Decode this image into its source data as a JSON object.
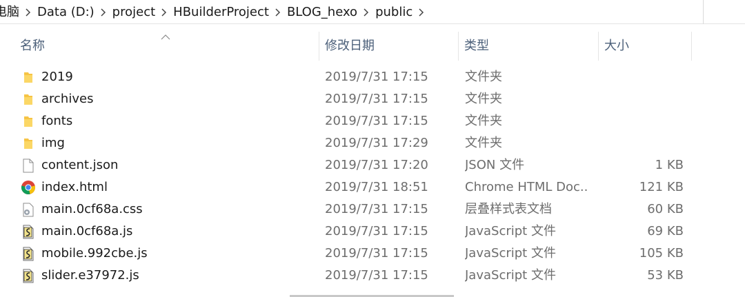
{
  "breadcrumb": {
    "items": [
      "电脑",
      "Data (D:)",
      "project",
      "HBuilderProject",
      "BLOG_hexo",
      "public"
    ]
  },
  "columns": {
    "name": "名称",
    "date": "修改日期",
    "type": "类型",
    "size": "大小"
  },
  "files": [
    {
      "name": "2019",
      "date": "2019/7/31 17:15",
      "type": "文件夹",
      "size": "",
      "icon": "folder-icon"
    },
    {
      "name": "archives",
      "date": "2019/7/31 17:15",
      "type": "文件夹",
      "size": "",
      "icon": "folder-icon"
    },
    {
      "name": "fonts",
      "date": "2019/7/31 17:15",
      "type": "文件夹",
      "size": "",
      "icon": "folder-icon"
    },
    {
      "name": "img",
      "date": "2019/7/31 17:29",
      "type": "文件夹",
      "size": "",
      "icon": "folder-icon"
    },
    {
      "name": "content.json",
      "date": "2019/7/31 17:20",
      "type": "JSON 文件",
      "size": "1 KB",
      "icon": "blank-file-icon"
    },
    {
      "name": "index.html",
      "date": "2019/7/31 18:51",
      "type": "Chrome HTML Doc...",
      "size": "121 KB",
      "icon": "chrome-icon"
    },
    {
      "name": "main.0cf68a.css",
      "date": "2019/7/31 17:15",
      "type": "层叠样式表文档",
      "size": "60 KB",
      "icon": "css-file-icon"
    },
    {
      "name": "main.0cf68a.js",
      "date": "2019/7/31 17:15",
      "type": "JavaScript 文件",
      "size": "69 KB",
      "icon": "js-file-icon"
    },
    {
      "name": "mobile.992cbe.js",
      "date": "2019/7/31 17:15",
      "type": "JavaScript 文件",
      "size": "105 KB",
      "icon": "js-file-icon"
    },
    {
      "name": "slider.e37972.js",
      "date": "2019/7/31 17:15",
      "type": "JavaScript 文件",
      "size": "53 KB",
      "icon": "js-file-icon"
    }
  ],
  "colors": {
    "header_text": "#4c607a",
    "folder": "#f6c445",
    "secondary_text": "#6d6d6d"
  }
}
